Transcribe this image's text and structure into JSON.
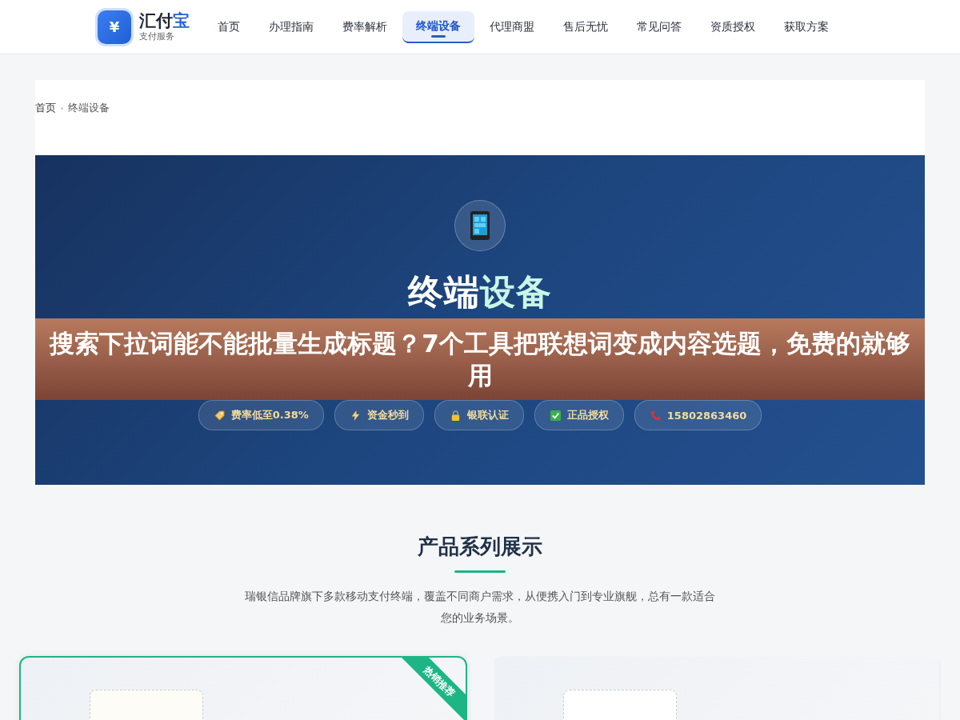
{
  "header": {
    "logo": {
      "glyph": "¥",
      "name_main": "汇付",
      "name_accent": "宝",
      "subtitle": "支付服务"
    },
    "nav": [
      {
        "label": "首页",
        "selected": false
      },
      {
        "label": "办理指南",
        "selected": false
      },
      {
        "label": "费率解析",
        "selected": false
      },
      {
        "label": "终端设备",
        "selected": true
      },
      {
        "label": "代理商盟",
        "selected": false
      },
      {
        "label": "售后无忧",
        "selected": false
      },
      {
        "label": "常见问答",
        "selected": false
      },
      {
        "label": "资质授权",
        "selected": false
      },
      {
        "label": "获取方案",
        "selected": false
      }
    ]
  },
  "breadcrumb": [
    "首页",
    "终端设备"
  ],
  "hero": {
    "title_main": "终端",
    "title_accent": "设备",
    "badges": [
      {
        "kind": "tag",
        "label": "费率低至0.38%"
      },
      {
        "kind": "bolt",
        "label": "资金秒到"
      },
      {
        "kind": "lock",
        "label": "银联认证"
      },
      {
        "kind": "check",
        "label": "正品授权"
      },
      {
        "kind": "phone",
        "label": "15802863460"
      }
    ]
  },
  "overlay_banner": {
    "text": "搜索下拉词能不能批量生成标题？7个工具把联想词变成内容选题，免费的就够用"
  },
  "products": {
    "title": "产品系列展示",
    "description": "瑞银信品牌旗下多款移动支付终端，覆盖不同商户需求，从便携入门到专业旗舰，总有一款适合您的业务场景。",
    "cards": [
      {
        "featured": true,
        "ribbon": "热销推荐"
      },
      {
        "featured": false
      }
    ]
  }
}
